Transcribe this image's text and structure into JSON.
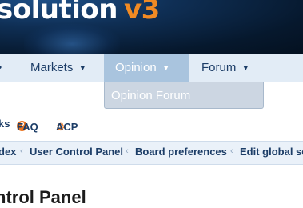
{
  "header": {
    "logo_word": "solution",
    "logo_version": "v3"
  },
  "nav": {
    "items": [
      {
        "label": "Markets"
      },
      {
        "label": "Opinion"
      },
      {
        "label": "Forum"
      }
    ],
    "active": "Opinion",
    "dropdown_items": [
      "Opinion Forum"
    ]
  },
  "quicklinks": {
    "partial": "ks",
    "faq": "FAQ",
    "acp": "ACP"
  },
  "breadcrumbs": [
    "dex",
    "User Control Panel",
    "Board preferences",
    "Edit global se"
  ],
  "page_title": "ntrol Panel",
  "colors": {
    "accent": "#f08a24",
    "nav_bg": "#e2ecf6",
    "nav_active": "#a9c4de",
    "link": "#1c3d67"
  }
}
